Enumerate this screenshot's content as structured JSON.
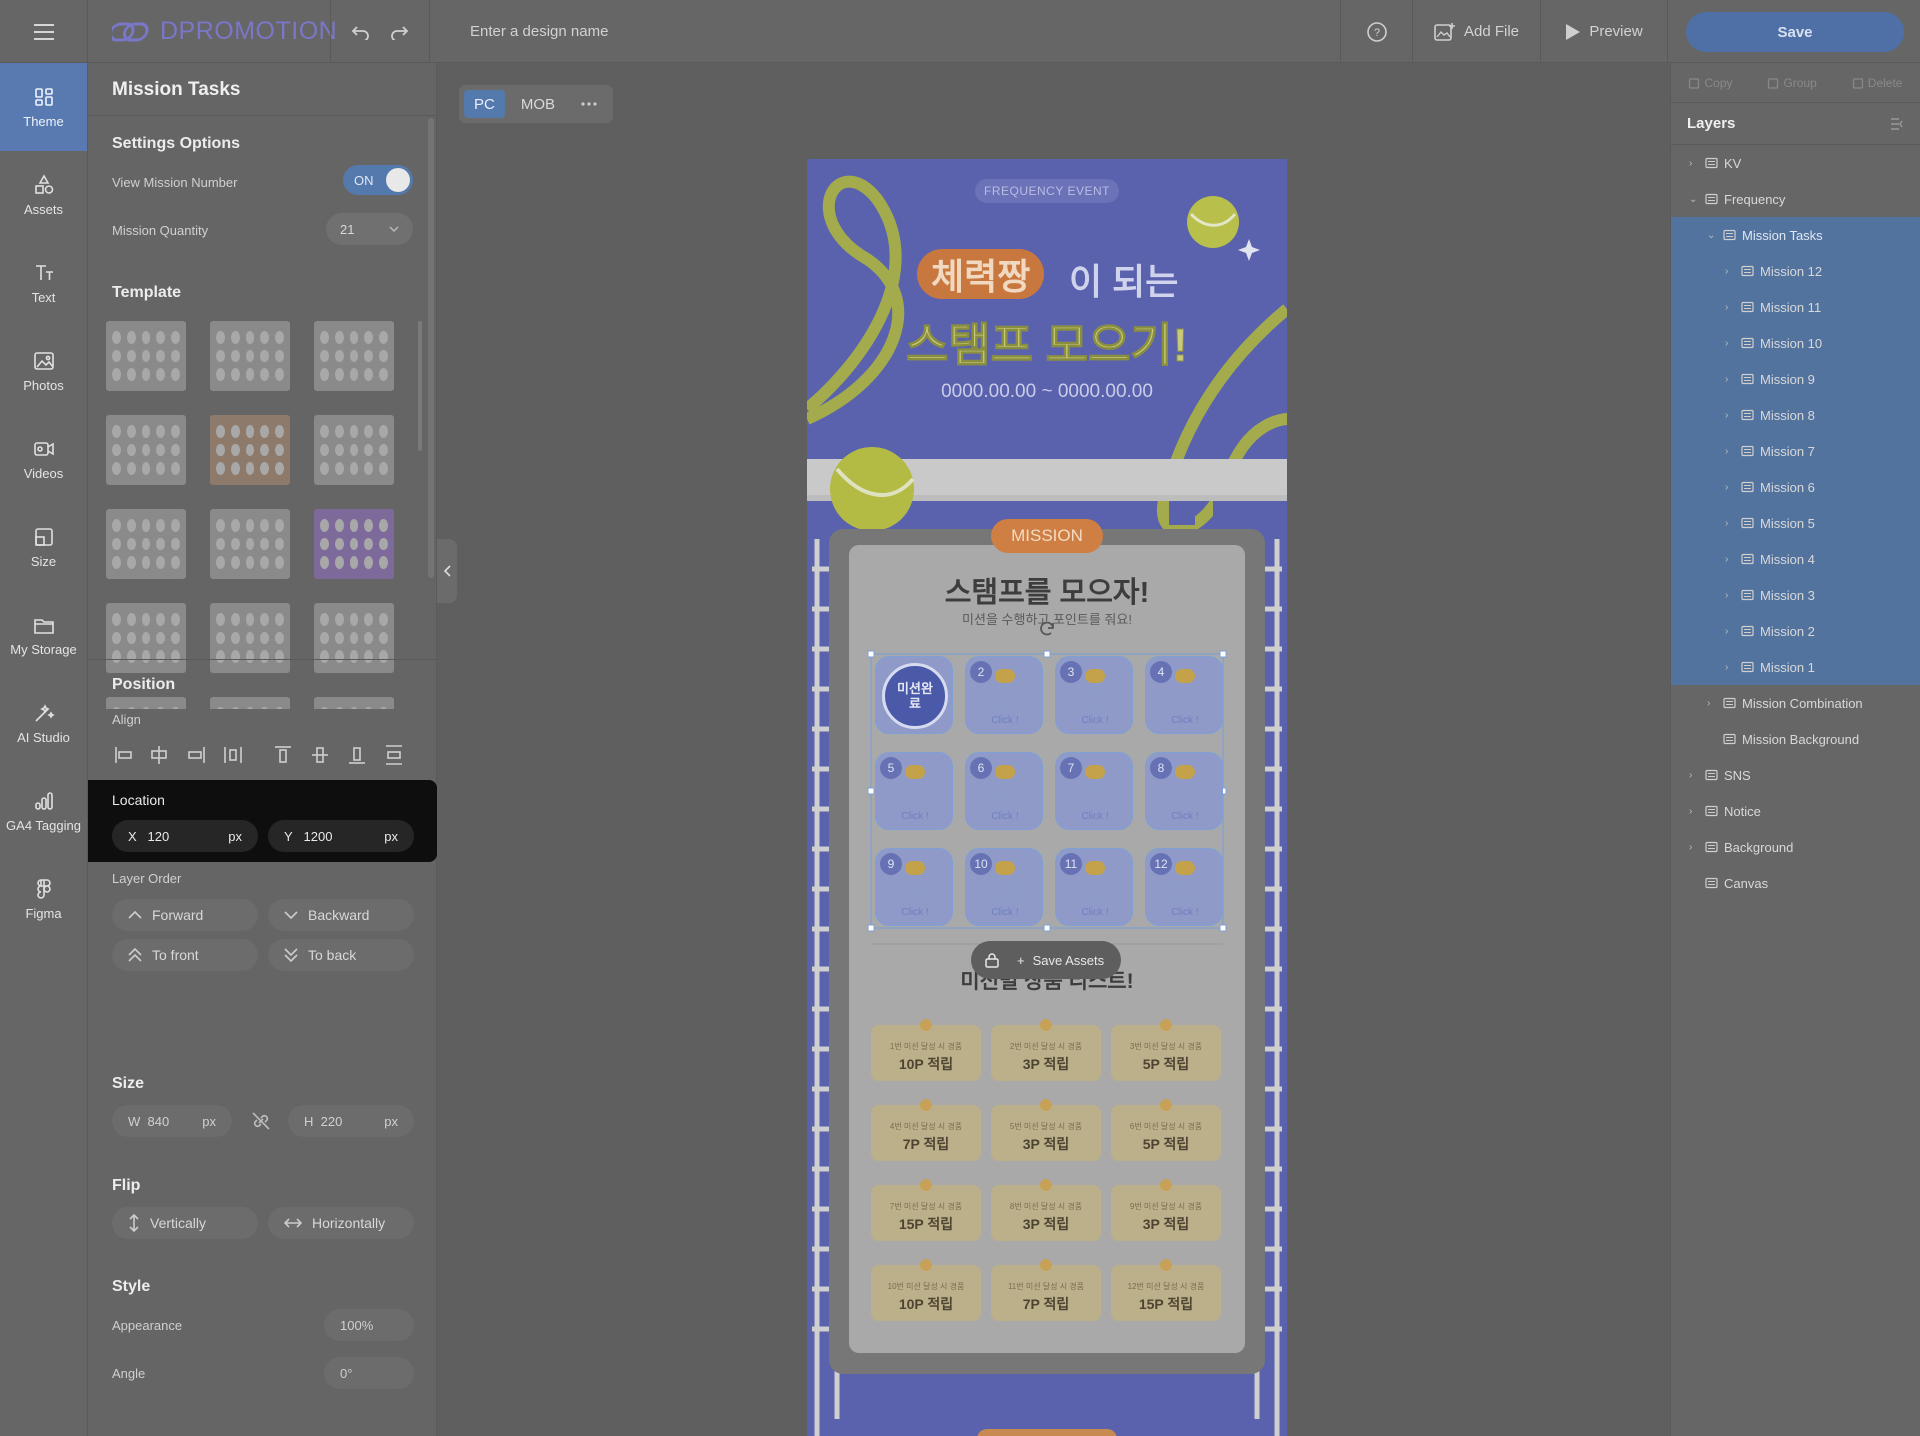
{
  "app": {
    "logo": "DPROMOTION",
    "design_name_placeholder": "Enter a design name",
    "add_file": "Add File",
    "preview": "Preview",
    "save": "Save"
  },
  "rail": [
    {
      "label": "Theme",
      "icon": "theme-icon",
      "active": true
    },
    {
      "label": "Assets",
      "icon": "assets-icon"
    },
    {
      "label": "Text",
      "icon": "text-icon"
    },
    {
      "label": "Photos",
      "icon": "photos-icon"
    },
    {
      "label": "Videos",
      "icon": "videos-icon"
    },
    {
      "label": "Size",
      "icon": "size-icon"
    },
    {
      "label": "My Storage",
      "icon": "folder-icon"
    },
    {
      "label": "AI Studio",
      "icon": "ai-studio-icon"
    },
    {
      "label": "GA4 Tagging",
      "icon": "ga4-icon"
    },
    {
      "label": "Figma",
      "icon": "figma-icon"
    }
  ],
  "panel": {
    "title": "Mission Tasks",
    "settings": {
      "heading": "Settings Options",
      "view_mission_number": "View Mission Number",
      "toggle": "ON",
      "mission_quantity": "Mission Quantity",
      "quantity_value": "21"
    },
    "template_heading": "Template",
    "position": {
      "heading": "Position",
      "align": "Align",
      "location": "Location",
      "x_label": "X",
      "x_value": "120",
      "y_label": "Y",
      "y_value": "1200",
      "unit": "px"
    },
    "layer_order": {
      "heading": "Layer Order",
      "forward": "Forward",
      "backward": "Backward",
      "to_front": "To front",
      "to_back": "To back"
    },
    "size": {
      "heading": "Size",
      "w_label": "W",
      "w_value": "840",
      "h_label": "H",
      "h_value": "220",
      "unit": "px"
    },
    "flip": {
      "heading": "Flip",
      "vertically": "Vertically",
      "horizontally": "Horizontally"
    },
    "style": {
      "heading": "Style",
      "appearance": "Appearance",
      "appearance_value": "100%",
      "angle": "Angle",
      "angle_value": "0°"
    }
  },
  "canvas": {
    "tabs": [
      "PC",
      "MOB"
    ],
    "active_tab": "PC"
  },
  "poster": {
    "badge": "FREQUENCY EVENT",
    "title_highlight": "체력짱",
    "title_rest": "이 되는",
    "title_line2": "스탬프 모으기!",
    "dates": "0000.00.00 ~ 0000.00.00",
    "mission_tag": "MISSION",
    "card_title": "스탬프를 모으자!",
    "card_sub": "미션을 수행하고 포인트를 줘요!",
    "stamp_done": "미션완료",
    "stamp_click": "Click !",
    "save_assets": "Save Assets",
    "reward_title": "미션별 상품 리스트!",
    "rewards": [
      {
        "cond": "1번 미션 달성 시 경품",
        "prize": "10P 적립"
      },
      {
        "cond": "2번 미션 달성 시 경품",
        "prize": "3P 적립"
      },
      {
        "cond": "3번 미션 달성 시 경품",
        "prize": "5P 적립"
      },
      {
        "cond": "4번 미션 달성 시 경품",
        "prize": "7P 적립"
      },
      {
        "cond": "5번 미션 달성 시 경품",
        "prize": "3P 적립"
      },
      {
        "cond": "6번 미션 달성 시 경품",
        "prize": "5P 적립"
      },
      {
        "cond": "7번 미션 달성 시 경품",
        "prize": "15P 적립"
      },
      {
        "cond": "8번 미션 달성 시 경품",
        "prize": "3P 적립"
      },
      {
        "cond": "9번 미션 달성 시 경품",
        "prize": "3P 적립"
      },
      {
        "cond": "10번 미션 달성 시 경품",
        "prize": "10P 적립"
      },
      {
        "cond": "11번 미션 달성 시 경품",
        "prize": "7P 적립"
      },
      {
        "cond": "12번 미션 달성 시 경품",
        "prize": "15P 적립"
      }
    ],
    "stamps": [
      "1",
      "2",
      "3",
      "4",
      "5",
      "6",
      "7",
      "8",
      "9",
      "10",
      "11",
      "12"
    ]
  },
  "right": {
    "actions": [
      "Copy",
      "Group",
      "Delete"
    ],
    "layers_title": "Layers",
    "layers": [
      {
        "name": "KV",
        "icon": "folder-icon",
        "level": 0,
        "chev": "›"
      },
      {
        "name": "Frequency",
        "icon": "component-icon",
        "level": 0,
        "chev": "⌄"
      },
      {
        "name": "Mission Tasks",
        "icon": "list-icon",
        "level": 1,
        "chev": "⌄",
        "selected": true
      },
      {
        "name": "Mission 12",
        "icon": "list-icon",
        "level": 2,
        "chev": "›",
        "sub": true
      },
      {
        "name": "Mission 11",
        "icon": "list-icon",
        "level": 2,
        "chev": "›",
        "sub": true
      },
      {
        "name": "Mission 10",
        "icon": "list-icon",
        "level": 2,
        "chev": "›",
        "sub": true
      },
      {
        "name": "Mission 9",
        "icon": "list-icon",
        "level": 2,
        "chev": "›",
        "sub": true
      },
      {
        "name": "Mission 8",
        "icon": "list-icon",
        "level": 2,
        "chev": "›",
        "sub": true
      },
      {
        "name": "Mission 7",
        "icon": "list-icon",
        "level": 2,
        "chev": "›",
        "sub": true
      },
      {
        "name": "Mission 6",
        "icon": "list-icon",
        "level": 2,
        "chev": "›",
        "sub": true
      },
      {
        "name": "Mission 5",
        "icon": "list-icon",
        "level": 2,
        "chev": "›",
        "sub": true
      },
      {
        "name": "Mission 4",
        "icon": "list-icon",
        "level": 2,
        "chev": "›",
        "sub": true
      },
      {
        "name": "Mission 3",
        "icon": "list-icon",
        "level": 2,
        "chev": "›",
        "sub": true
      },
      {
        "name": "Mission 2",
        "icon": "list-icon",
        "level": 2,
        "chev": "›",
        "sub": true
      },
      {
        "name": "Mission 1",
        "icon": "list-icon",
        "level": 2,
        "chev": "›",
        "sub": true
      },
      {
        "name": "Mission Combination",
        "icon": "copy-icon",
        "level": 1,
        "chev": "›"
      },
      {
        "name": "Mission Background",
        "icon": "frame-icon",
        "level": 1,
        "chev": ""
      },
      {
        "name": "SNS",
        "icon": "folder-icon",
        "level": 0,
        "chev": "›"
      },
      {
        "name": "Notice",
        "icon": "folder-icon",
        "level": 0,
        "chev": "›"
      },
      {
        "name": "Background",
        "icon": "folder-icon",
        "level": 0,
        "chev": "›"
      },
      {
        "name": "Canvas",
        "icon": "page-icon",
        "level": 0,
        "chev": ""
      }
    ]
  },
  "colors": {
    "accent": "#4f70a6",
    "poster_bg": "#5a62ad",
    "orange": "#d27b3f",
    "lime": "#a9b24a"
  }
}
